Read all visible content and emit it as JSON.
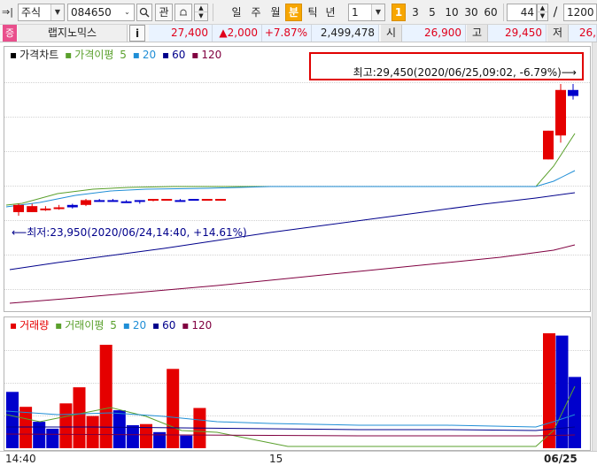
{
  "toolbar": {
    "market": "주식",
    "code": "084650",
    "btn_search_mag": "🔍",
    "btn_gwan": "관",
    "periods": [
      "일",
      "주",
      "월",
      "분",
      "틱",
      "년"
    ],
    "active_period": "분",
    "interval_value": "1",
    "interval_highlight": "1",
    "intervals": [
      "3",
      "5",
      "10",
      "30",
      "60"
    ],
    "count_value": "44",
    "slash": "/",
    "total_value": "1200"
  },
  "quote": {
    "name": "랩지노믹스",
    "info_btn": "i",
    "price": "27,400",
    "change": "▲2,000",
    "rate": "+7.87%",
    "volume": "2,499,478",
    "open_label": "시",
    "open_value": "26,900",
    "high_label": "고",
    "high_value": "29,450",
    "low_label": "저",
    "low_value": "26,"
  },
  "price_panel": {
    "legend": {
      "title": "가격차트",
      "ma_label": "가격이평",
      "ma5": "5",
      "ma20": "20",
      "ma60": "60",
      "ma120": "120"
    },
    "high_annotation": "최고:29,450(2020/06/25,09:02, -6.79%)⟶",
    "low_annotation": "⟵최저:23,950(2020/06/24,14:40, +14.61%)"
  },
  "volume_panel": {
    "legend": {
      "title": "거래량",
      "ma_label": "거래이평",
      "ma5": "5",
      "ma20": "20",
      "ma60": "60",
      "ma120": "120"
    }
  },
  "xaxis": {
    "left": "14:40",
    "mid": "15",
    "right": "06/25"
  },
  "colors": {
    "up": "#e50000",
    "down": "#0000cc",
    "ma5": "#5aa02c",
    "ma20": "#1f8ed6",
    "ma60": "#00008b",
    "ma120": "#800040",
    "highlight": "#f7a600"
  },
  "chart_data": {
    "type": "candlestick",
    "x_labels": [
      "14:40",
      "15",
      "06/25"
    ],
    "price": {
      "high": 29450,
      "low": 23950,
      "candles": [
        {
          "o": 24400,
          "c": 24100,
          "h": 24450,
          "l": 23950,
          "dir": "up"
        },
        {
          "o": 24100,
          "c": 24350,
          "h": 24450,
          "l": 24100,
          "dir": "up"
        },
        {
          "o": 24200,
          "c": 24250,
          "h": 24350,
          "l": 24150,
          "dir": "up"
        },
        {
          "o": 24250,
          "c": 24300,
          "h": 24400,
          "l": 24200,
          "dir": "up"
        },
        {
          "o": 24300,
          "c": 24400,
          "h": 24450,
          "l": 24250,
          "dir": "down"
        },
        {
          "o": 24400,
          "c": 24600,
          "h": 24650,
          "l": 24350,
          "dir": "up"
        },
        {
          "o": 24600,
          "c": 24550,
          "h": 24650,
          "l": 24550,
          "dir": "down"
        },
        {
          "o": 24550,
          "c": 24600,
          "h": 24650,
          "l": 24550,
          "dir": "down"
        },
        {
          "o": 24550,
          "c": 24550,
          "h": 24600,
          "l": 24500,
          "dir": "down"
        },
        {
          "o": 24600,
          "c": 24550,
          "h": 24600,
          "l": 24450,
          "dir": "down"
        },
        {
          "o": 24600,
          "c": 24650,
          "h": 24650,
          "l": 24550,
          "dir": "up"
        },
        {
          "o": 24600,
          "c": 24650,
          "h": 24650,
          "l": 24600,
          "dir": "up"
        },
        {
          "o": 24600,
          "c": 24600,
          "h": 24650,
          "l": 24550,
          "dir": "down"
        },
        {
          "o": 24650,
          "c": 24600,
          "h": 24650,
          "l": 24600,
          "dir": "down"
        },
        {
          "o": 24600,
          "c": 24650,
          "h": 24650,
          "l": 24600,
          "dir": "up"
        },
        {
          "o": 24600,
          "c": 24650,
          "h": 24650,
          "l": 24600,
          "dir": "up"
        },
        {
          "o": 26300,
          "c": 27500,
          "h": 27500,
          "l": 26300,
          "dir": "up"
        },
        {
          "o": 27300,
          "c": 29200,
          "h": 29450,
          "l": 27000,
          "dir": "up"
        },
        {
          "o": 29200,
          "c": 28950,
          "h": 29450,
          "l": 28800,
          "dir": "down"
        }
      ]
    },
    "volume": {
      "bars": [
        {
          "v": 0.49,
          "dir": "down"
        },
        {
          "v": 0.36,
          "dir": "up"
        },
        {
          "v": 0.23,
          "dir": "down"
        },
        {
          "v": 0.17,
          "dir": "down"
        },
        {
          "v": 0.39,
          "dir": "up"
        },
        {
          "v": 0.53,
          "dir": "up"
        },
        {
          "v": 0.28,
          "dir": "up"
        },
        {
          "v": 0.9,
          "dir": "up"
        },
        {
          "v": 0.33,
          "dir": "down"
        },
        {
          "v": 0.2,
          "dir": "down"
        },
        {
          "v": 0.21,
          "dir": "up"
        },
        {
          "v": 0.14,
          "dir": "down"
        },
        {
          "v": 0.69,
          "dir": "up"
        },
        {
          "v": 0.11,
          "dir": "down"
        },
        {
          "v": 0.35,
          "dir": "up"
        },
        {
          "v": 1.0,
          "dir": "up"
        },
        {
          "v": 0.98,
          "dir": "down"
        },
        {
          "v": 0.62,
          "dir": "down"
        }
      ]
    }
  }
}
